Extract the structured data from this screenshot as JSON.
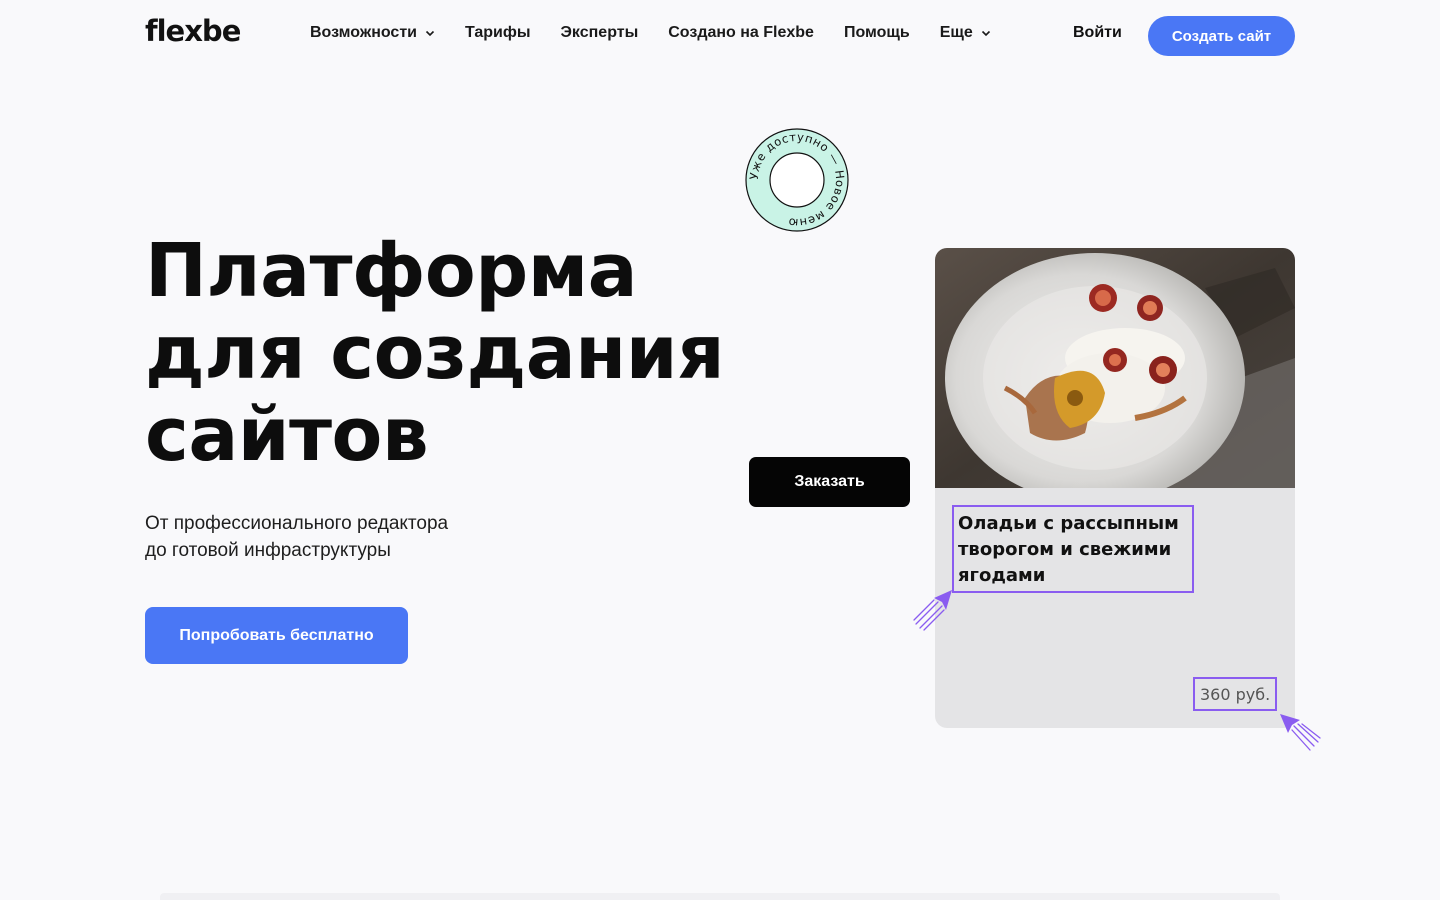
{
  "header": {
    "logo": "flexbe",
    "nav": [
      {
        "label": "Возможности",
        "has_dropdown": true
      },
      {
        "label": "Тарифы",
        "has_dropdown": false
      },
      {
        "label": "Эксперты",
        "has_dropdown": false
      },
      {
        "label": "Создано на Flexbe",
        "has_dropdown": false
      },
      {
        "label": "Помощь",
        "has_dropdown": false
      },
      {
        "label": "Еще",
        "has_dropdown": true
      }
    ],
    "login_label": "Войти",
    "create_site_label": "Создать сайт"
  },
  "hero": {
    "title_lines": [
      "Платформа",
      "для создания",
      "сайтов"
    ],
    "subtitle_lines": [
      "От профессионального редактора",
      "до готовой инфраструктуры"
    ],
    "cta_label": "Попробовать бесплатно"
  },
  "badge": {
    "text": "Уже доступно — Новое меню"
  },
  "demo": {
    "order_label": "Заказать",
    "dish_title_lines": [
      "Оладьи с рассыпным",
      "творогом и свежими",
      "ягодами"
    ],
    "price": "360 руб."
  },
  "colors": {
    "accent": "#4a77f5",
    "selection": "#8a5cf0",
    "badge_fill": "#c9f3e6",
    "card_bg": "#e4e4e6",
    "page_bg": "#f9f9fb"
  }
}
